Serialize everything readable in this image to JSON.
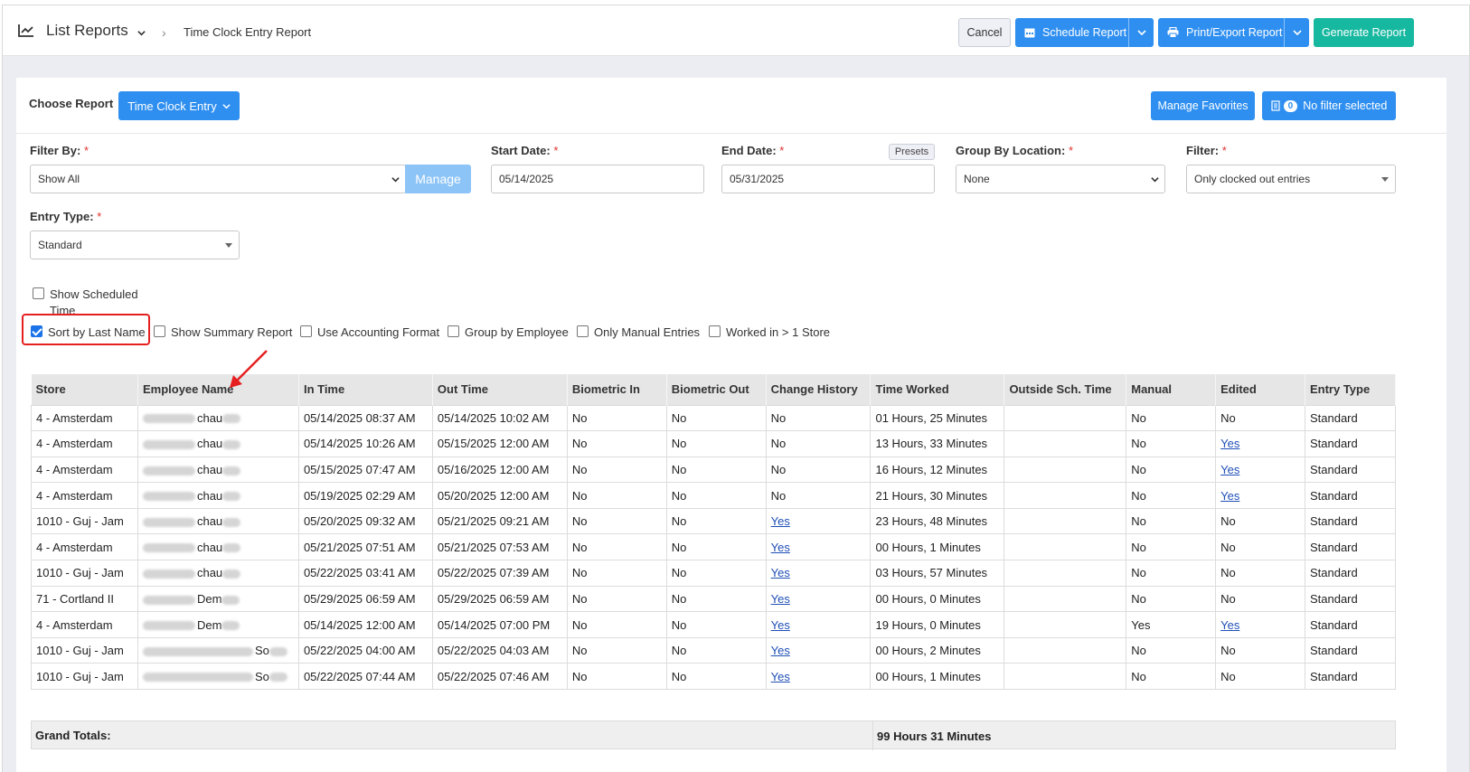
{
  "header": {
    "title": "List Reports",
    "breadcrumb": "Time Clock Entry Report",
    "cancel_label": "Cancel",
    "schedule_label": "Schedule Report",
    "print_label": "Print/Export Report",
    "generate_label": "Generate Report"
  },
  "controls": {
    "choose_report_label": "Choose Report",
    "report_button_label": "Time Clock Entry",
    "manage_favorites_label": "Manage Favorites",
    "filter_count": "0",
    "no_filter_label": "No filter selected",
    "filter_by_label": "Filter By:",
    "filter_by_value": "Show All",
    "manage_label": "Manage",
    "start_date_label": "Start Date:",
    "start_date_value": "05/14/2025",
    "end_date_label": "End Date:",
    "end_date_value": "05/31/2025",
    "presets_label": "Presets",
    "group_by_location_label": "Group By Location:",
    "group_by_location_value": "None",
    "filter_label": "Filter:",
    "filter_value": "Only clocked out entries",
    "entry_type_label": "Entry Type:",
    "entry_type_value": "Standard",
    "required_mark": "*"
  },
  "options": {
    "show_scheduled_time": {
      "label_line1": "Show Scheduled",
      "label_line2": "Time",
      "checked": false
    },
    "sort_by_last_name": {
      "label": "Sort by Last Name",
      "checked": true
    },
    "show_summary_report": {
      "label": "Show Summary Report",
      "checked": false
    },
    "use_accounting_format": {
      "label": "Use Accounting Format",
      "checked": false
    },
    "group_by_employee": {
      "label": "Group by Employee",
      "checked": false
    },
    "only_manual_entries": {
      "label": "Only Manual Entries",
      "checked": false
    },
    "worked_in_gt_1_store": {
      "label": "Worked in > 1 Store",
      "checked": false
    }
  },
  "table": {
    "columns": [
      "Store",
      "Employee Name",
      "In Time",
      "Out Time",
      "Biometric In",
      "Biometric Out",
      "Change History",
      "Time Worked",
      "Outside Sch. Time",
      "Manual",
      "Edited",
      "Entry Type"
    ],
    "rows": [
      {
        "store": "4 - Amsterdam",
        "employee": "chau",
        "in": "05/14/2025 08:37 AM",
        "out": "05/14/2025 10:02 AM",
        "bio_in": "No",
        "bio_out": "No",
        "history": "No",
        "worked": "01 Hours, 25 Minutes",
        "outside": "",
        "manual": "No",
        "edited": "No",
        "type": "Standard"
      },
      {
        "store": "4 - Amsterdam",
        "employee": "chau",
        "in": "05/14/2025 10:26 AM",
        "out": "05/15/2025 12:00 AM",
        "bio_in": "No",
        "bio_out": "No",
        "history": "No",
        "worked": "13 Hours, 33 Minutes",
        "outside": "",
        "manual": "No",
        "edited": "Yes",
        "type": "Standard"
      },
      {
        "store": "4 - Amsterdam",
        "employee": "chau",
        "in": "05/15/2025 07:47 AM",
        "out": "05/16/2025 12:00 AM",
        "bio_in": "No",
        "bio_out": "No",
        "history": "No",
        "worked": "16 Hours, 12 Minutes",
        "outside": "",
        "manual": "No",
        "edited": "Yes",
        "type": "Standard"
      },
      {
        "store": "4 - Amsterdam",
        "employee": "chau",
        "in": "05/19/2025 02:29 AM",
        "out": "05/20/2025 12:00 AM",
        "bio_in": "No",
        "bio_out": "No",
        "history": "No",
        "worked": "21 Hours, 30 Minutes",
        "outside": "",
        "manual": "No",
        "edited": "Yes",
        "type": "Standard"
      },
      {
        "store": "1010 - Guj - Jam",
        "employee": "chau",
        "in": "05/20/2025 09:32 AM",
        "out": "05/21/2025 09:21 AM",
        "bio_in": "No",
        "bio_out": "No",
        "history": "Yes",
        "worked": "23 Hours, 48 Minutes",
        "outside": "",
        "manual": "No",
        "edited": "No",
        "type": "Standard"
      },
      {
        "store": "4 - Amsterdam",
        "employee": "chau",
        "in": "05/21/2025 07:51 AM",
        "out": "05/21/2025 07:53 AM",
        "bio_in": "No",
        "bio_out": "No",
        "history": "Yes",
        "worked": "00 Hours, 1 Minutes",
        "outside": "",
        "manual": "No",
        "edited": "No",
        "type": "Standard"
      },
      {
        "store": "1010 - Guj - Jam",
        "employee": "chau",
        "in": "05/22/2025 03:41 AM",
        "out": "05/22/2025 07:39 AM",
        "bio_in": "No",
        "bio_out": "No",
        "history": "Yes",
        "worked": "03 Hours, 57 Minutes",
        "outside": "",
        "manual": "No",
        "edited": "No",
        "type": "Standard"
      },
      {
        "store": "71 - Cortland II",
        "employee": "Dem",
        "in": "05/29/2025 06:59 AM",
        "out": "05/29/2025 06:59 AM",
        "bio_in": "No",
        "bio_out": "No",
        "history": "Yes",
        "worked": "00 Hours, 0 Minutes",
        "outside": "",
        "manual": "No",
        "edited": "No",
        "type": "Standard"
      },
      {
        "store": "4 - Amsterdam",
        "employee": "Dem",
        "in": "05/14/2025 12:00 AM",
        "out": "05/14/2025 07:00 PM",
        "bio_in": "No",
        "bio_out": "No",
        "history": "Yes",
        "worked": "19 Hours, 0 Minutes",
        "outside": "",
        "manual": "Yes",
        "edited": "Yes",
        "type": "Standard"
      },
      {
        "store": "1010 - Guj - Jam",
        "employee": "So",
        "in": "05/22/2025 04:00 AM",
        "out": "05/22/2025 04:03 AM",
        "bio_in": "No",
        "bio_out": "No",
        "history": "Yes",
        "worked": "00 Hours, 2 Minutes",
        "outside": "",
        "manual": "No",
        "edited": "No",
        "type": "Standard"
      },
      {
        "store": "1010 - Guj - Jam",
        "employee": "So",
        "in": "05/22/2025 07:44 AM",
        "out": "05/22/2025 07:46 AM",
        "bio_in": "No",
        "bio_out": "No",
        "history": "Yes",
        "worked": "00 Hours, 1 Minutes",
        "outside": "",
        "manual": "No",
        "edited": "No",
        "type": "Standard"
      }
    ]
  },
  "totals": {
    "label": "Grand Totals:",
    "time_worked": "99 Hours 31 Minutes"
  },
  "colors": {
    "primary": "#2f8ff0",
    "generate": "#17b8a0",
    "highlight": "#e61f1f",
    "link": "#1f4fb6"
  }
}
